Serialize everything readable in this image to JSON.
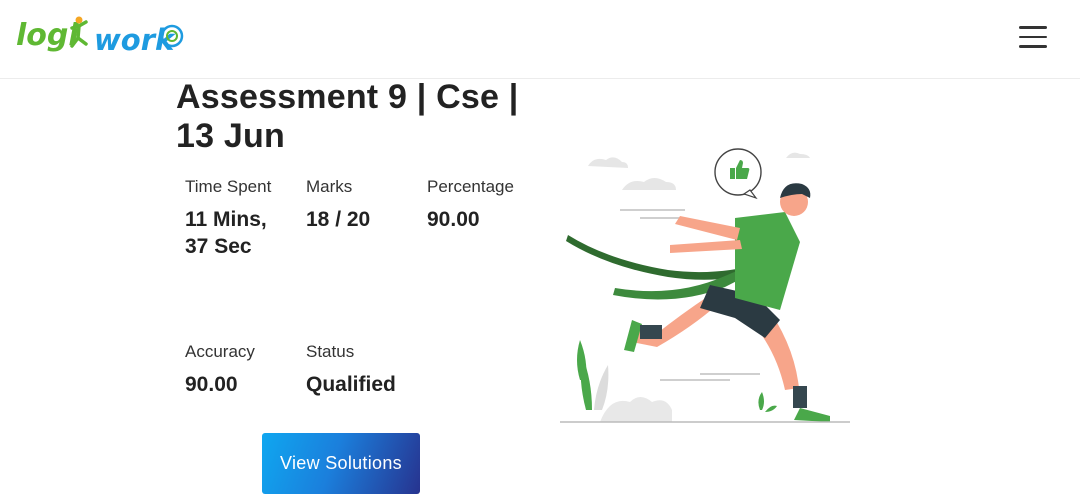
{
  "header": {
    "logo": {
      "text_part1": "logi",
      "text_part2": "work",
      "color_green": "#5fb833",
      "color_blue": "#1e9be0"
    },
    "menu_icon": "hamburger-menu-icon"
  },
  "assessment": {
    "title": "Assessment 9 | Cse | 13 Jun"
  },
  "stats": {
    "time_spent": {
      "label": "Time Spent",
      "value": "11 Mins, 37 Sec"
    },
    "marks": {
      "label": "Marks",
      "value": "18 / 20"
    },
    "percentage": {
      "label": "Percentage",
      "value": "90.00"
    },
    "accuracy": {
      "label": "Accuracy",
      "value": "90.00"
    },
    "status": {
      "label": "Status",
      "value": "Qualified"
    }
  },
  "actions": {
    "view_solutions_label": "View Solutions"
  },
  "illustration": {
    "icon": "runner-finish-line-illustration",
    "accent_color": "#4aa84a"
  }
}
